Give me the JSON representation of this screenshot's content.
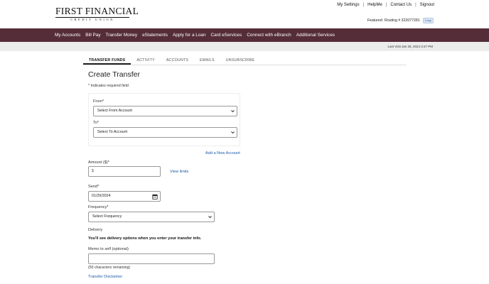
{
  "logo": {
    "main": "FIRST FINANCIAL",
    "sub": "CREDIT UNION"
  },
  "utility_links": [
    "My Settings",
    "HelpMe",
    "Contact Us",
    "Signout"
  ],
  "featured": {
    "label": "Featured:",
    "routing": "Routing # 322077281",
    "copy_label": "Copy"
  },
  "nav": [
    "My Accounts",
    "Bill Pay",
    "Transfer Money",
    "eStatements",
    "Apply for a Loan",
    "Card eServices",
    "Connect with eBranch",
    "Additional Services"
  ],
  "last_visit": "Last Visit Jan 25, 2024 3:47 PM",
  "tabs": [
    {
      "label": "TRANSFER FUNDS",
      "active": true
    },
    {
      "label": "ACTIVITY",
      "active": false
    },
    {
      "label": "ACCOUNTS",
      "active": false
    },
    {
      "label": "EMAILS",
      "active": false
    },
    {
      "label": "UNSUBSCRIBE",
      "active": false
    }
  ],
  "form": {
    "title": "Create Transfer",
    "required_note": "* Indicates required field",
    "from_label": "From*",
    "from_value": "Select From Account",
    "to_label": "To*",
    "to_value": "Select To Account",
    "add_account": "Add a New Account",
    "amount_label": "Amount ($)*",
    "amount_placeholder": "$",
    "view_limits": "View limits",
    "send_label": "Send*",
    "send_value": "01/29/2024",
    "frequency_label": "Frequency*",
    "frequency_value": "Select Frequency",
    "delivery_label": "Delivery",
    "delivery_note": "You'll see delivery options when you enter your transfer info.",
    "memo_label": "Memo to self (optional)",
    "memo_value": "",
    "chars_remaining": "(50 characters remaining)",
    "disclaimer": "Transfer Disclaimer"
  },
  "colors": {
    "nav_bg": "#552d38",
    "link": "#1e5aa8",
    "banner_bg": "#ececec"
  }
}
